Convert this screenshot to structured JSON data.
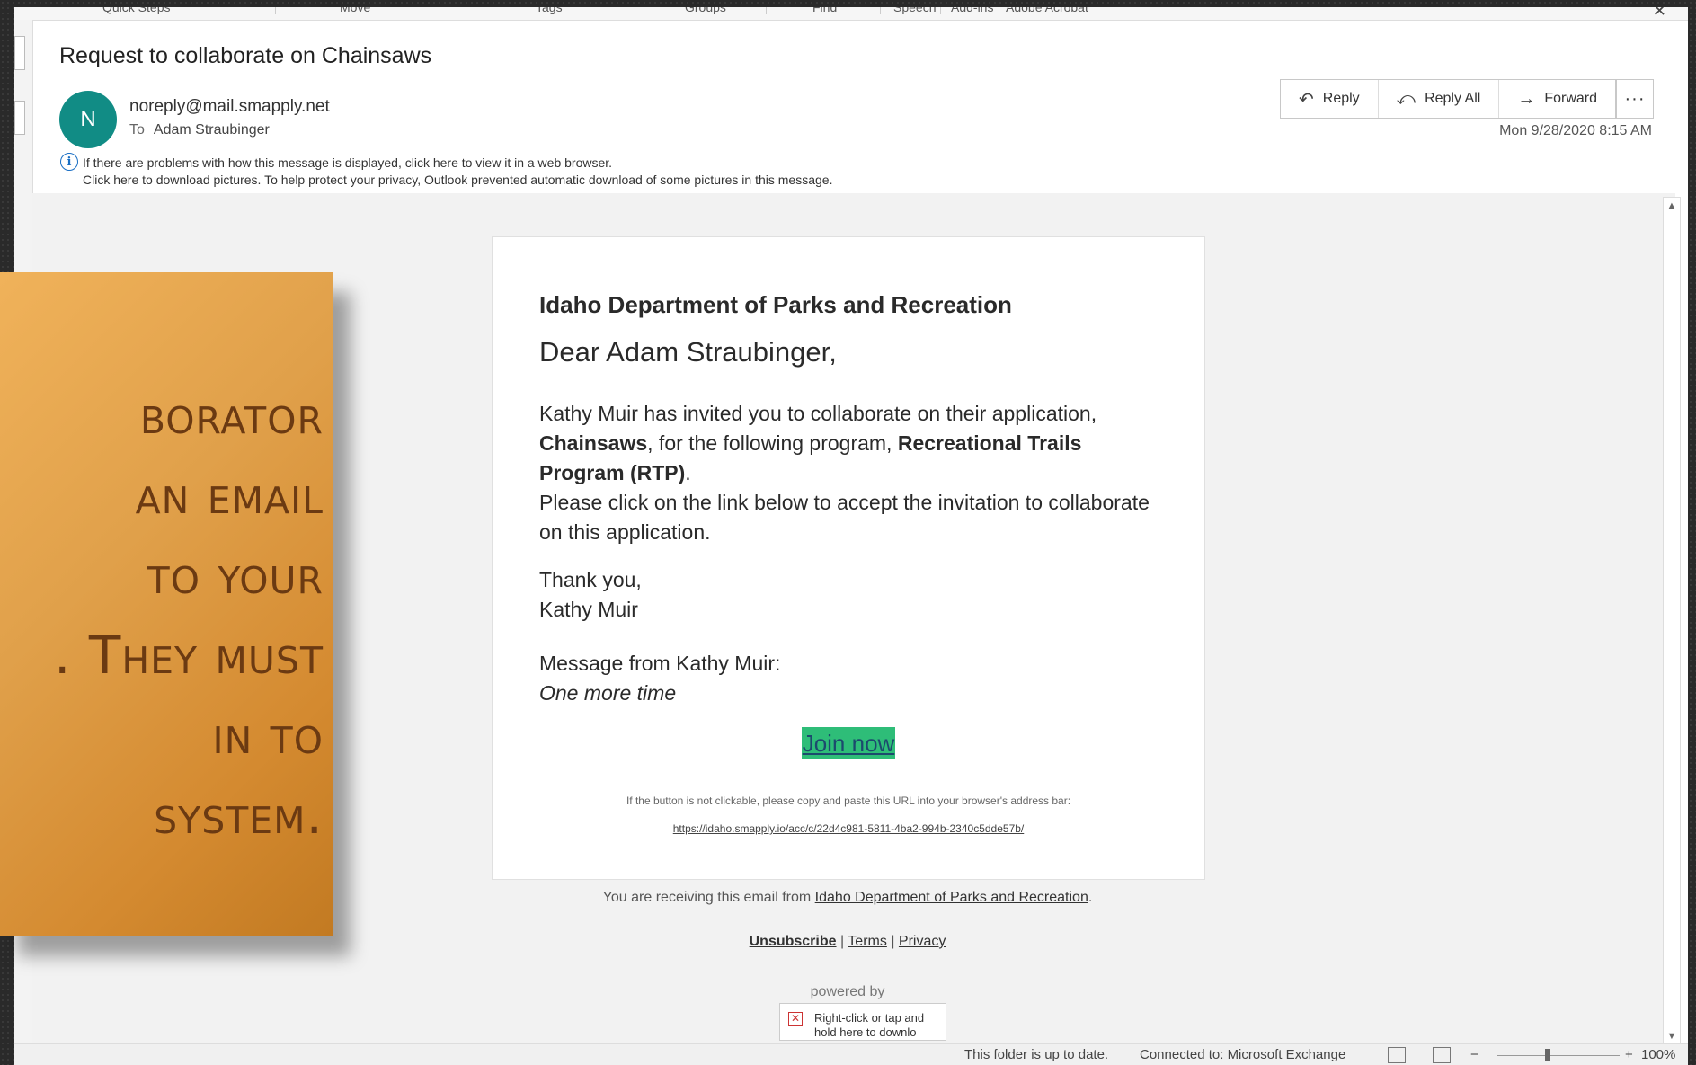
{
  "ribbon": {
    "groups": [
      "Quick Steps",
      "Move",
      "Tags",
      "Groups",
      "Find",
      "Speech",
      "Add-ins",
      "Adobe Acrobat"
    ]
  },
  "message": {
    "subject": "Request to collaborate on Chainsaws",
    "avatar_initial": "N",
    "sender": "noreply@mail.smapply.net",
    "to_label": "To",
    "to_name": "Adam Straubinger",
    "info_line1": "If there are problems with how this message is displayed, click here to view it in a web browser.",
    "info_line2": "Click here to download pictures. To help protect your privacy, Outlook prevented automatic download of some pictures in this message.",
    "datetime": "Mon 9/28/2020 8:15 AM"
  },
  "actions": {
    "reply": "Reply",
    "reply_all": "Reply All",
    "forward": "Forward",
    "more": "···"
  },
  "email": {
    "org": "Idaho Department of Parks and Recreation",
    "greeting": "Dear Adam Straubinger,",
    "p1_a": "Kathy Muir has invited you to collaborate on their application,",
    "p1_app": "Chainsaws",
    "p1_b": ", for the following program,",
    "p1_program": "Recreational Trails Program (RTP)",
    "p1_c": ".",
    "p2": "Please click on the link below to accept the invitation to collaborate on this application.",
    "thanks": "Thank you,",
    "sign_name": "Kathy Muir",
    "msg_label": "Message from Kathy Muir:",
    "msg_text": "One more time",
    "join_label": "Join now",
    "fallback": "If the button is not clickable, please copy and paste this URL into your browser's address bar:",
    "url": "https://idaho.smapply.io/acc/c/22d4c981-5811-4ba2-994b-2340c5dde57b/"
  },
  "footer": {
    "receiving_prefix": "You are receiving this email from",
    "receiving_org": "Idaho Department of Parks and Recreation",
    "receiving_suffix": ".",
    "unsubscribe": "Unsubscribe",
    "terms": "Terms",
    "privacy": "Privacy",
    "sep": "|",
    "powered_by": "powered by",
    "broken_image_text": "Right-click or tap and hold here to downlo"
  },
  "statusbar": {
    "folder_status": "This folder is up to date.",
    "connection": "Connected to: Microsoft Exchange",
    "zoom": "100%"
  },
  "overlay": {
    "lines": [
      "borator",
      "an email",
      "to your",
      ". They must",
      "in to",
      "system."
    ]
  },
  "colors": {
    "avatar": "#118c85",
    "join_button": "#2ebd78",
    "overlay_orange": "#e0a04a",
    "overlay_text": "#6b3a12"
  }
}
